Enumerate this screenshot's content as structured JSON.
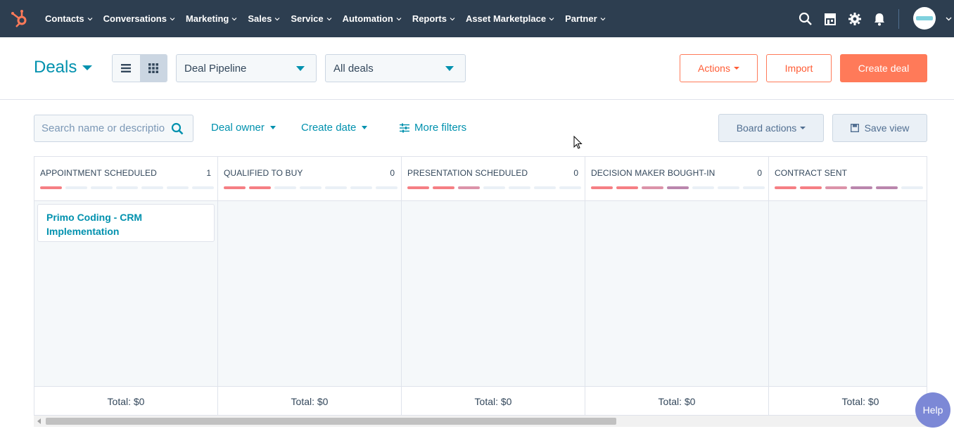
{
  "nav": {
    "items": [
      {
        "label": "Contacts"
      },
      {
        "label": "Conversations"
      },
      {
        "label": "Marketing"
      },
      {
        "label": "Sales"
      },
      {
        "label": "Service"
      },
      {
        "label": "Automation"
      },
      {
        "label": "Reports"
      },
      {
        "label": "Asset Marketplace"
      },
      {
        "label": "Partner"
      }
    ],
    "icons": [
      "search-icon",
      "marketplace-icon",
      "settings-icon",
      "notifications-icon"
    ],
    "colors": {
      "background": "#2d3e50",
      "logo": "#ff7a59"
    }
  },
  "header": {
    "title": "Deals",
    "pipeline_select": "Deal Pipeline",
    "view_select": "All deals",
    "actions_label": "Actions",
    "import_label": "Import",
    "create_label": "Create deal"
  },
  "filters": {
    "search_placeholder": "Search name or description",
    "deal_owner": "Deal owner",
    "create_date": "Create date",
    "more_filters": "More filters",
    "board_actions": "Board actions",
    "save_view": "Save view"
  },
  "board": {
    "columns": [
      {
        "name": "APPOINTMENT SCHEDULED",
        "count": "1",
        "total": "Total: $0",
        "filled": 1,
        "cards": [
          {
            "title": "Primo Coding - CRM Implementation"
          }
        ]
      },
      {
        "name": "QUALIFIED TO BUY",
        "count": "0",
        "total": "Total: $0",
        "filled": 2,
        "cards": []
      },
      {
        "name": "PRESENTATION SCHEDULED",
        "count": "0",
        "total": "Total: $0",
        "filled": 3,
        "cards": []
      },
      {
        "name": "DECISION MAKER BOUGHT-IN",
        "count": "0",
        "total": "Total: $0",
        "filled": 4,
        "cards": []
      },
      {
        "name": "CONTRACT SENT",
        "count": "",
        "total": "Total: $0",
        "filled": 5,
        "cards": []
      }
    ],
    "stage_colors": [
      "#f2545b",
      "#f2545b",
      "#d06f8c",
      "#a35e92",
      "#a35e92"
    ]
  },
  "scroll": {
    "position": 0.0,
    "visible_fraction": 0.67
  },
  "help_label": "Help"
}
